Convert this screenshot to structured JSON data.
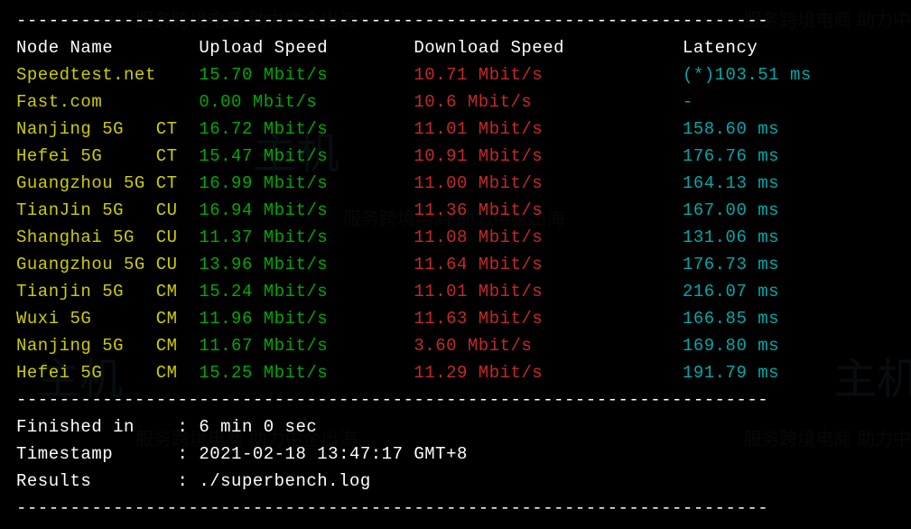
{
  "header": {
    "node_name": "Node Name",
    "upload": "Upload Speed",
    "download": "Download Speed",
    "latency": "Latency"
  },
  "rows": [
    {
      "node_left": "Speedtest.net",
      "node_right": "",
      "upload": "15.70 Mbit/s",
      "download": "10.71 Mbit/s",
      "latency": "(*)103.51 ms"
    },
    {
      "node_left": "Fast.com",
      "node_right": "",
      "upload": "0.00 Mbit/s",
      "download": "10.6 Mbit/s",
      "latency": "-"
    },
    {
      "node_left": "Nanjing 5G",
      "node_right": "CT",
      "upload": "16.72 Mbit/s",
      "download": "11.01 Mbit/s",
      "latency": "158.60 ms"
    },
    {
      "node_left": "Hefei 5G",
      "node_right": "CT",
      "upload": "15.47 Mbit/s",
      "download": "10.91 Mbit/s",
      "latency": "176.76 ms"
    },
    {
      "node_left": "Guangzhou 5G",
      "node_right": "CT",
      "upload": "16.99 Mbit/s",
      "download": "11.00 Mbit/s",
      "latency": "164.13 ms"
    },
    {
      "node_left": "TianJin 5G",
      "node_right": "CU",
      "upload": "16.94 Mbit/s",
      "download": "11.36 Mbit/s",
      "latency": "167.00 ms"
    },
    {
      "node_left": "Shanghai 5G",
      "node_right": "CU",
      "upload": "11.37 Mbit/s",
      "download": "11.08 Mbit/s",
      "latency": "131.06 ms"
    },
    {
      "node_left": "Guangzhou 5G",
      "node_right": "CU",
      "upload": "13.96 Mbit/s",
      "download": "11.64 Mbit/s",
      "latency": "176.73 ms"
    },
    {
      "node_left": "Tianjin 5G",
      "node_right": "CM",
      "upload": "15.24 Mbit/s",
      "download": "11.01 Mbit/s",
      "latency": "216.07 ms"
    },
    {
      "node_left": "Wuxi 5G",
      "node_right": "CM",
      "upload": "11.96 Mbit/s",
      "download": "11.63 Mbit/s",
      "latency": "166.85 ms"
    },
    {
      "node_left": "Nanjing 5G",
      "node_right": "CM",
      "upload": "11.67 Mbit/s",
      "download": "3.60 Mbit/s",
      "latency": "169.80 ms"
    },
    {
      "node_left": "Hefei 5G",
      "node_right": "CM",
      "upload": "15.25 Mbit/s",
      "download": "11.29 Mbit/s",
      "latency": "191.79 ms"
    }
  ],
  "footer": {
    "finished_label": "Finished in",
    "finished_value": "6 min 0 sec",
    "timestamp_label": "Timestamp",
    "timestamp_value": "2021-02-18 13:47:17 GMT+8",
    "results_label": "Results",
    "results_value": "./superbench.log"
  },
  "layout": {
    "col_node": 17,
    "col_upload": 20,
    "col_download": 25,
    "footer_label_width": 15
  },
  "divider": "----------------------------------------------------------------------"
}
